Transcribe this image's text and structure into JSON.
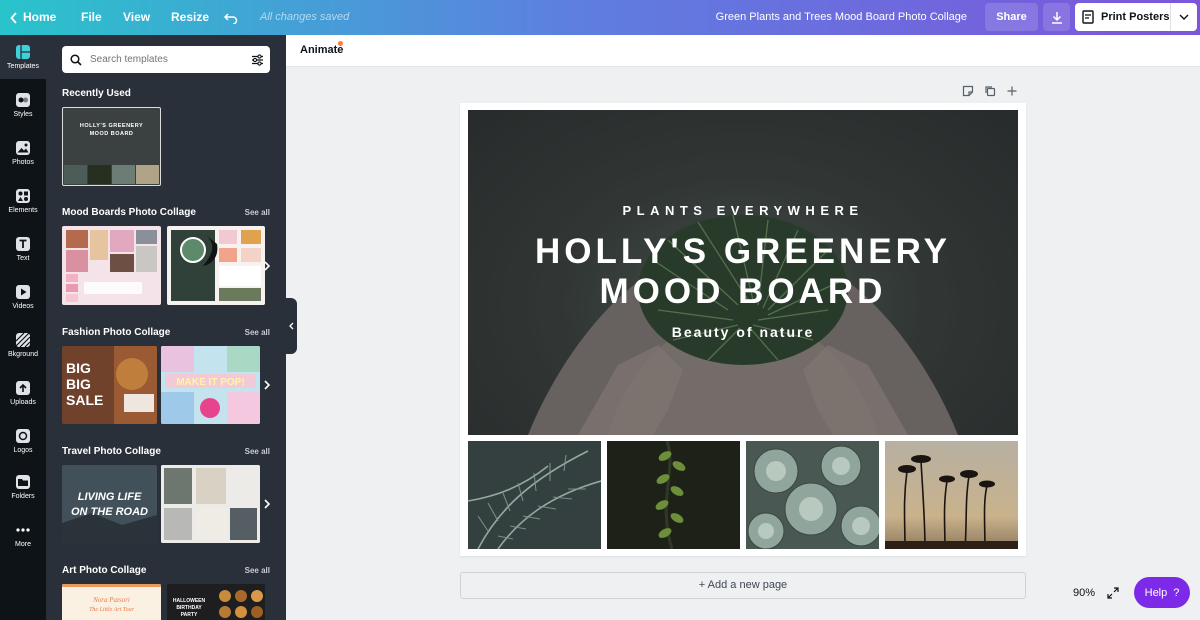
{
  "topbar": {
    "home_label": "Home",
    "file_label": "File",
    "view_label": "View",
    "resize_label": "Resize",
    "saved_status": "All changes saved",
    "doc_title": "Green Plants and Trees Mood Board Photo Collage",
    "share_label": "Share",
    "print_label": "Print Posters",
    "gradient": [
      "#29c4cb",
      "#5e7ee0",
      "#7d55db"
    ]
  },
  "rail": {
    "items": [
      {
        "label": "Templates",
        "icon": "templates-icon"
      },
      {
        "label": "Styles",
        "icon": "styles-icon"
      },
      {
        "label": "Photos",
        "icon": "photos-icon"
      },
      {
        "label": "Elements",
        "icon": "elements-icon"
      },
      {
        "label": "Text",
        "icon": "text-icon"
      },
      {
        "label": "Videos",
        "icon": "videos-icon"
      },
      {
        "label": "Bkground",
        "icon": "background-icon"
      },
      {
        "label": "Uploads",
        "icon": "uploads-icon"
      },
      {
        "label": "Logos",
        "icon": "logos-icon"
      },
      {
        "label": "Folders",
        "icon": "folders-icon"
      },
      {
        "label": "More",
        "icon": "more-icon"
      }
    ]
  },
  "panel": {
    "search_placeholder": "Search templates",
    "recent_title": "Recently Used",
    "recent_thumb": {
      "line1": "HOLLY'S GREENERY",
      "line2": "MOOD BOARD"
    },
    "sections": [
      {
        "title": "Mood Boards Photo Collage",
        "see_all": "See all"
      },
      {
        "title": "Fashion Photo Collage",
        "see_all": "See all"
      },
      {
        "title": "Travel Photo Collage",
        "see_all": "See all"
      },
      {
        "title": "Art Photo Collage",
        "see_all": "See all"
      }
    ],
    "thumb_text": {
      "fashion_1": [
        "BIG",
        "BIG",
        "SALE"
      ],
      "fashion_2": "MAKE IT POP!",
      "travel_1": [
        "LIVING LIFE",
        "ON THE ROAD"
      ],
      "art_1": [
        "Nora Patsori",
        "The Little Art Tour"
      ],
      "art_2": [
        "HALLOWEEN",
        "BIRTHDAY",
        "PARTY"
      ]
    }
  },
  "editor": {
    "animate_label": "Animate",
    "hero_subtitle": "PLANTS EVERYWHERE",
    "hero_title_1": "HOLLY'S GREENERY",
    "hero_title_2": "MOOD BOARD",
    "hero_tagline": "Beauty of nature",
    "add_page_label": "+ Add a new page",
    "zoom": "90%",
    "help_label": "Help",
    "help_mark": "?"
  }
}
